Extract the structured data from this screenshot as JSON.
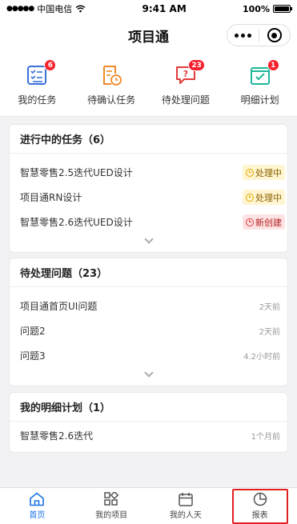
{
  "status_bar": {
    "carrier": "中国电信",
    "time": "9:41 AM",
    "battery": "100%"
  },
  "nav": {
    "title": "项目通"
  },
  "shortcuts": [
    {
      "label": "我的任务",
      "badge": "6",
      "icon": "task-list-icon"
    },
    {
      "label": "待确认任务",
      "badge": "",
      "icon": "pending-confirm-icon"
    },
    {
      "label": "待处理问题",
      "badge": "23",
      "icon": "question-icon"
    },
    {
      "label": "明细计划",
      "badge": "1",
      "icon": "checklist-icon"
    }
  ],
  "tasks": {
    "title": "进行中的任务（6）",
    "items": [
      {
        "name": "智慧零售2.5迭代UED设计",
        "status": "处理中"
      },
      {
        "name": "项目通RN设计",
        "status": "处理中"
      },
      {
        "name": "智慧零售2.6迭代UED设计",
        "status": "新创建"
      }
    ]
  },
  "issues": {
    "title": "待处理问题（23）",
    "items": [
      {
        "name": "项目通首页UI问题",
        "time": "2天前"
      },
      {
        "name": "问题2",
        "time": "2天前"
      },
      {
        "name": "问题3",
        "time": "4.2小时前"
      }
    ]
  },
  "plans": {
    "title": "我的明细计划（1）",
    "items": [
      {
        "name": "智慧零售2.6迭代",
        "time": "1个月前"
      }
    ]
  },
  "tabbar": {
    "tabs": [
      {
        "label": "首页",
        "icon": "home-icon",
        "active": true
      },
      {
        "label": "我的项目",
        "icon": "grid-icon"
      },
      {
        "label": "我的人天",
        "icon": "calendar-icon"
      },
      {
        "label": "报表",
        "icon": "pie-chart-icon"
      }
    ]
  },
  "colors": {
    "accent": "#1a73e8",
    "badge": "#f5222d",
    "processing_bg": "#fff5d1",
    "new_bg": "#fde3e3",
    "highlight": "#e02020"
  }
}
